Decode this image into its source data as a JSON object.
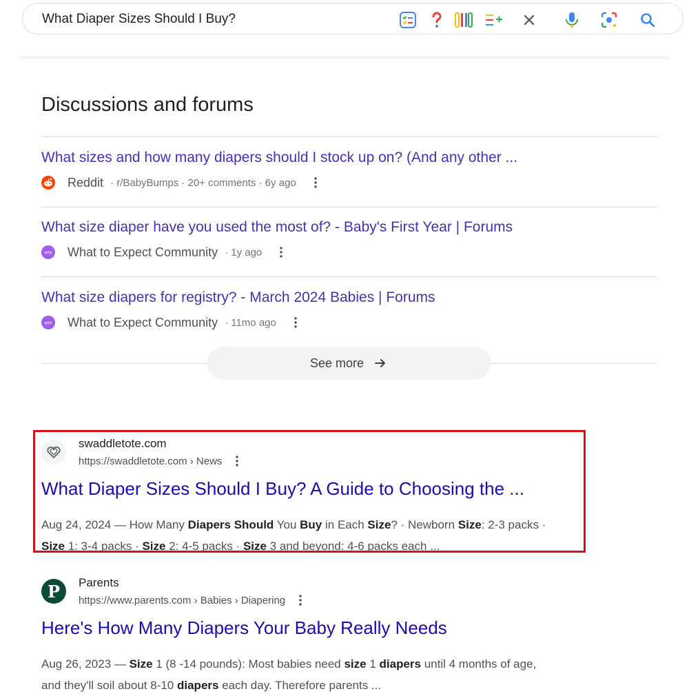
{
  "search": {
    "query": "What Diaper Sizes Should I Buy?"
  },
  "toolbar_icons": [
    "checklist-icon",
    "question-icon",
    "compare-icon",
    "add-list-icon",
    "close-icon",
    "microphone-icon",
    "lens-icon",
    "search-icon"
  ],
  "discussions": {
    "title": "Discussions and forums",
    "items": [
      {
        "title": "What sizes and how many diapers should I stock up on? (And any other ...",
        "source": "Reddit",
        "extra": "· r/BabyBumps · 20+ comments · 6y ago",
        "icon": "reddit-icon"
      },
      {
        "title": "What size diaper have you used the most of? - Baby's First Year | Forums",
        "source": "What to Expect Community",
        "extra": "· 1y ago",
        "icon": "what-to-expect-icon"
      },
      {
        "title": "What size diapers for registry? - March 2024 Babies | Forums",
        "source": "What to Expect Community",
        "extra": "· 11mo ago",
        "icon": "what-to-expect-icon"
      }
    ],
    "see_more": "See more"
  },
  "results": [
    {
      "site": "swaddletote.com",
      "url": "https://swaddletote.com › News",
      "title": "What Diaper Sizes Should I Buy? A Guide to Choosing the ...",
      "snippet_line1": [
        {
          "t": "Aug 24, 2024 — How Many ",
          "b": false
        },
        {
          "t": "Diapers Should",
          "b": true
        },
        {
          "t": " You ",
          "b": false
        },
        {
          "t": "Buy",
          "b": true
        },
        {
          "t": " in Each ",
          "b": false
        },
        {
          "t": "Size",
          "b": true
        },
        {
          "t": "? · Newborn ",
          "b": false
        },
        {
          "t": "Size",
          "b": true
        },
        {
          "t": ": 2-3 packs ·",
          "b": false
        }
      ],
      "snippet_line2": [
        {
          "t": "Size",
          "b": true
        },
        {
          "t": " 1: 3-4 packs · ",
          "b": false
        },
        {
          "t": "Size",
          "b": true
        },
        {
          "t": " 2: 4-5 packs · ",
          "b": false
        },
        {
          "t": "Size",
          "b": true
        },
        {
          "t": " 3 and beyond: 4-6 packs each ...",
          "b": false
        }
      ]
    },
    {
      "site": "Parents",
      "favicon_letter": "P",
      "url": "https://www.parents.com › Babies › Diapering",
      "title": "Here's How Many Diapers Your Baby Really Needs",
      "snippet_line1": [
        {
          "t": "Aug 26, 2023 — ",
          "b": false
        },
        {
          "t": "Size",
          "b": true
        },
        {
          "t": " 1 (8 -14 pounds): Most babies need ",
          "b": false
        },
        {
          "t": "size",
          "b": true
        },
        {
          "t": " 1 ",
          "b": false
        },
        {
          "t": "diapers",
          "b": true
        },
        {
          "t": " until 4 months of age,",
          "b": false
        }
      ],
      "snippet_line2": [
        {
          "t": "and they'll soil about 8-10 ",
          "b": false
        },
        {
          "t": "diapers",
          "b": true
        },
        {
          "t": " each day. Therefore parents ...",
          "b": false
        }
      ]
    }
  ],
  "colors": {
    "link_visited": "#4a2fb0",
    "link": "#1a0dab",
    "highlight": "#d0121b",
    "reddit": "#ff4500",
    "what_to_expect": "#9f5fe8",
    "parents": "#0d4a3a"
  }
}
